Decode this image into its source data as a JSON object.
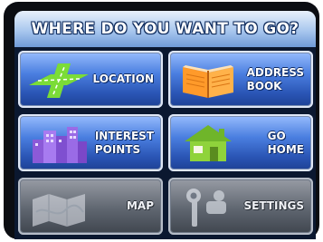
{
  "header": {
    "title": "WHERE DO YOU WANT TO GO?"
  },
  "tiles": [
    {
      "label": "LOCATION",
      "icon": "crossroads-icon"
    },
    {
      "label": "ADDRESS\nBOOK",
      "icon": "open-book-icon"
    },
    {
      "label": "INTEREST\nPOINTS",
      "icon": "city-buildings-icon"
    },
    {
      "label": "GO\nHOME",
      "icon": "house-icon"
    },
    {
      "label": "MAP",
      "icon": "map-icon"
    },
    {
      "label": "SETTINGS",
      "icon": "tools-icon"
    }
  ],
  "colors": {
    "tile_blue": "#2a55b5",
    "tile_gray": "#5f6670",
    "road_green": "#7bdc37",
    "book_orange": "#ff9a2a",
    "city_purple": "#8b5ad8",
    "house_green": "#8fd33b"
  }
}
